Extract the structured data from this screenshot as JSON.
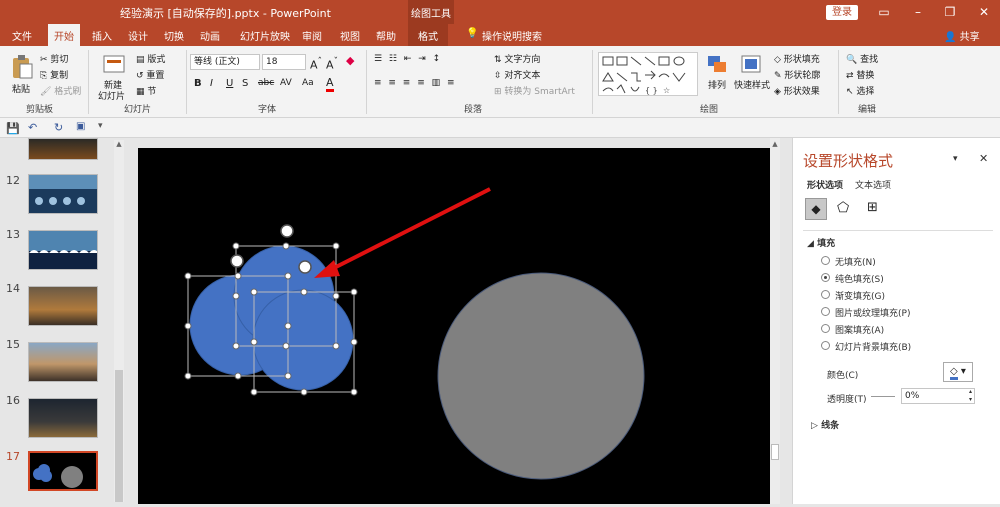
{
  "window": {
    "title": "经验演示 [自动保存的].pptx  -  PowerPoint",
    "context_tool": "绘图工具",
    "login": "登录",
    "share": "共享"
  },
  "tabs": [
    "文件",
    "开始",
    "插入",
    "设计",
    "切换",
    "动画",
    "幻灯片放映",
    "审阅",
    "视图",
    "帮助",
    "格式"
  ],
  "tell_me": "操作说明搜索",
  "ribbon": {
    "clipboard": {
      "label": "剪贴板",
      "paste": "粘贴",
      "cut": "剪切",
      "copy": "复制",
      "format_painter": "格式刷"
    },
    "slides": {
      "label": "幻灯片",
      "new_slide": "新建",
      "new_slide2": "幻灯片",
      "layout": "版式",
      "reset": "重置",
      "section": "节"
    },
    "font": {
      "label": "字体",
      "font_name": "等线 (正文)",
      "font_size": "18",
      "bold": "B",
      "italic": "I",
      "underline": "U",
      "strike": "S",
      "shadow": "abc",
      "spacing": "AV",
      "case": "Aa",
      "color": "A"
    },
    "paragraph": {
      "label": "段落",
      "text_direction": "文字方向",
      "align_text": "对齐文本",
      "smartart": "转换为 SmartArt"
    },
    "drawing": {
      "label": "绘图",
      "arrange": "排列",
      "quick_styles": "快速样式",
      "fill": "形状填充",
      "outline": "形状轮廓",
      "effects": "形状效果"
    },
    "editing": {
      "label": "编辑",
      "find": "查找",
      "replace": "替换",
      "select": "选择"
    }
  },
  "slide_numbers": [
    "12",
    "13",
    "14",
    "15",
    "16",
    "17"
  ],
  "format_pane": {
    "title": "设置形状格式",
    "tab_shape": "形状选项",
    "tab_text": "文本选项",
    "section_fill": "填充",
    "fill_options": [
      "无填充(N)",
      "纯色填充(S)",
      "渐变填充(G)",
      "图片或纹理填充(P)",
      "图案填充(A)",
      "幻灯片背景填充(B)"
    ],
    "selected_fill": 1,
    "color_label": "颜色(C)",
    "transparency_label": "透明度(T)",
    "transparency_value": "0%",
    "section_line": "线条"
  },
  "colors": {
    "accent": "#b7472a",
    "circle_blue": "#4472c4",
    "circle_gray": "#808080"
  }
}
